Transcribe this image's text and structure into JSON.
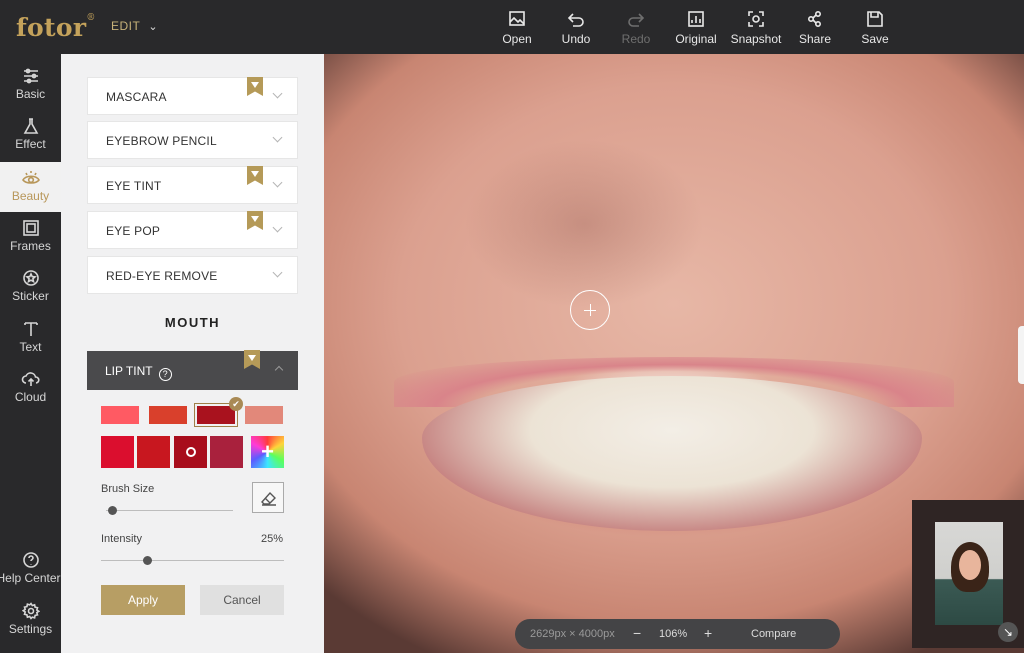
{
  "app": {
    "logo": "fotor",
    "logo_mark": "®",
    "mode_label": "EDIT"
  },
  "toolbar": [
    {
      "label": "Open",
      "icon": "open-image-icon",
      "enabled": true
    },
    {
      "label": "Undo",
      "icon": "undo-icon",
      "enabled": true
    },
    {
      "label": "Redo",
      "icon": "redo-icon",
      "enabled": false
    },
    {
      "label": "Original",
      "icon": "original-image-icon",
      "enabled": true
    },
    {
      "label": "Snapshot",
      "icon": "snapshot-icon",
      "enabled": true
    },
    {
      "label": "Share",
      "icon": "share-icon",
      "enabled": true
    },
    {
      "label": "Save",
      "icon": "save-icon",
      "enabled": true
    }
  ],
  "leftnav": {
    "items": [
      {
        "label": "Basic",
        "icon": "sliders-icon",
        "active": false
      },
      {
        "label": "Effect",
        "icon": "flask-icon",
        "active": false
      },
      {
        "label": "Beauty",
        "icon": "eye-icon",
        "active": true
      },
      {
        "label": "Frames",
        "icon": "frame-icon",
        "active": false
      },
      {
        "label": "Sticker",
        "icon": "star-sticker-icon",
        "active": false
      },
      {
        "label": "Text",
        "icon": "text-icon",
        "active": false
      },
      {
        "label": "Cloud",
        "icon": "cloud-upload-icon",
        "active": false
      }
    ],
    "bottom_items": [
      {
        "label": "Help Center",
        "icon": "help-icon"
      },
      {
        "label": "Settings",
        "icon": "gear-icon"
      }
    ]
  },
  "panel": {
    "eye_tools": [
      {
        "label": "MASCARA",
        "premium": true
      },
      {
        "label": "EYEBROW PENCIL",
        "premium": false
      },
      {
        "label": "EYE TINT",
        "premium": true
      },
      {
        "label": "EYE POP",
        "premium": true
      },
      {
        "label": "RED-EYE REMOVE",
        "premium": false
      }
    ],
    "section_title": "MOUTH",
    "lip_tint": {
      "label": "LIP TINT",
      "help_glyph": "?",
      "premium": true,
      "colors": [
        "#ff5a63",
        "#d9402c",
        "#a9121e",
        "#e2887a",
        "#db0e2e",
        "#c8171f",
        "#a80d1c",
        "#a9213d"
      ],
      "selected_color_index": 2,
      "brush_size_label": "Brush Size",
      "brush_size_value": 0.05,
      "intensity_label": "Intensity",
      "intensity_value": "25%",
      "intensity_fraction": 0.25
    },
    "apply_label": "Apply",
    "cancel_label": "Cancel"
  },
  "canvas": {
    "image_size": "2629px × 4000px",
    "zoom": "106%",
    "zoom_out_glyph": "−",
    "zoom_in_glyph": "+",
    "compare_label": "Compare"
  },
  "colors": {
    "accent": "#b79e64",
    "dark_bg": "#29292b",
    "panel_bg": "#f1f1f2"
  }
}
